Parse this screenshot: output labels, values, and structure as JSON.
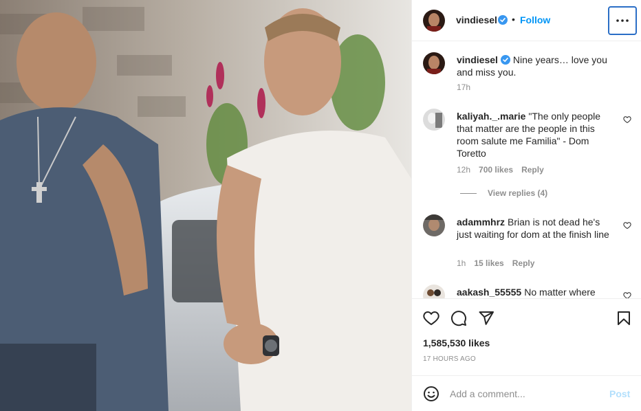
{
  "post": {
    "author": "vindiesel",
    "follow_label": "Follow",
    "separator": "•"
  },
  "comments": [
    {
      "username": "vindiesel",
      "text": "Nine years… love you and miss you.",
      "time": "17h",
      "verified": true
    },
    {
      "username": "kaliyah._.marie",
      "text": "\"The only people that matter are the people in this room salute me Familia\" - Dom Toretto",
      "time": "12h",
      "likes": "700 likes",
      "reply_label": "Reply",
      "view_replies": "View replies (4)"
    },
    {
      "username": "adammhrz",
      "text": "Brian is not dead he's just waiting for dom at the finish line",
      "time": "1h",
      "likes": "15 likes",
      "reply_label": "Reply"
    },
    {
      "username": "aakash_55555",
      "text": "No matter where"
    }
  ],
  "stats": {
    "likes": "1,585,530 likes",
    "time_ago": "17 HOURS AGO"
  },
  "composer": {
    "placeholder": "Add a comment...",
    "post_label": "Post"
  },
  "colors": {
    "accent": "#0095f6",
    "verified": "#3897f0",
    "muted": "#8e8e8e",
    "post_disabled": "#b2dffc",
    "focus_ring": "#2a6ec6"
  },
  "icons": {
    "header": [
      "verified-badge-icon",
      "more-options-icon"
    ],
    "actions": [
      "heart-icon",
      "comment-icon",
      "share-icon",
      "bookmark-icon"
    ],
    "composer": [
      "emoji-icon"
    ]
  }
}
